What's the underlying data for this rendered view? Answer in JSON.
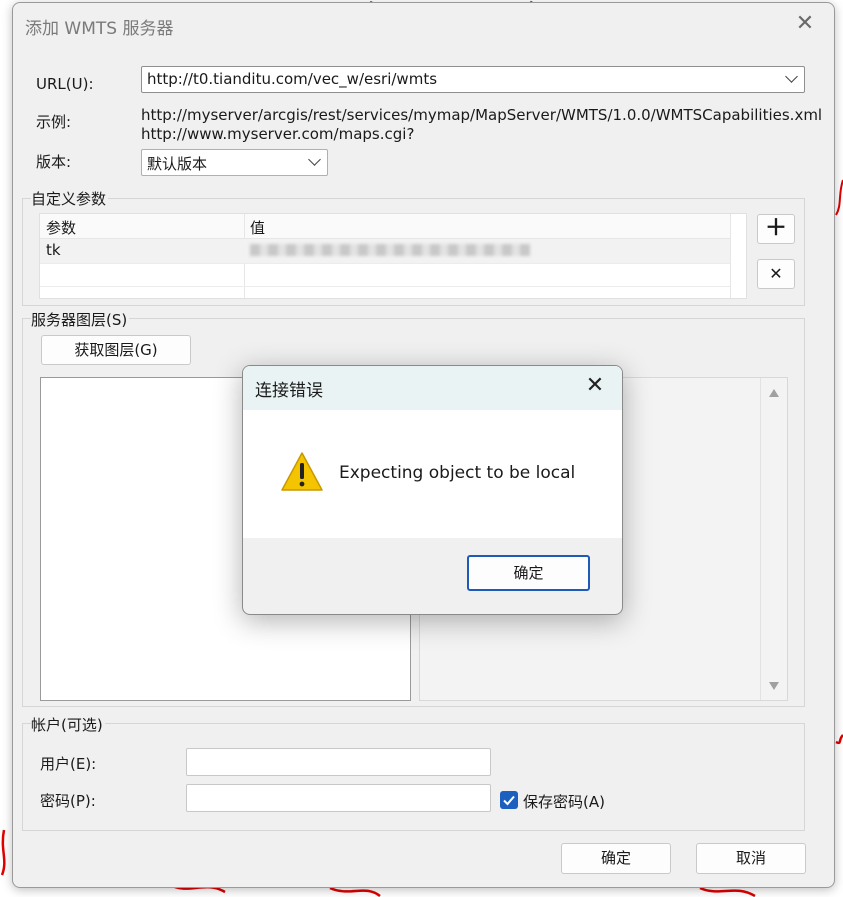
{
  "dialog": {
    "title": "添加 WMTS 服务器",
    "url_label": "URL(U):",
    "url_value": "http://t0.tianditu.com/vec_w/esri/wmts",
    "example_label": "示例:",
    "example_lines": [
      "http://myserver/arcgis/rest/services/mymap/MapServer/WMTS/1.0.0/WMTSCapabilities.xml",
      "http://www.myserver.com/maps.cgi?"
    ],
    "version_label": "版本:",
    "version_value": "默认版本",
    "custom_params": {
      "title": "自定义参数",
      "col_param": "参数",
      "col_value": "值",
      "rows": [
        {
          "param": "tk",
          "value": ""
        }
      ]
    },
    "server_layers": {
      "title": "服务器图层(S)",
      "get_layers_button": "获取图层(G)"
    },
    "account": {
      "title": "帐户(可选)",
      "user_label": "用户(E):",
      "user_value": "",
      "password_label": "密码(P):",
      "password_value": "",
      "save_password_label": "保存密码(A)",
      "save_password_checked": true
    },
    "ok_button": "确定",
    "cancel_button": "取消"
  },
  "error_dialog": {
    "title": "连接错误",
    "message": "Expecting object to be local",
    "ok_button": "确定",
    "icon": "warning-icon"
  },
  "colors": {
    "accent": "#1d5fbf",
    "warning": "#f5c400",
    "error_header": "#e9f3f3",
    "background_squiggles": "#e00000"
  }
}
